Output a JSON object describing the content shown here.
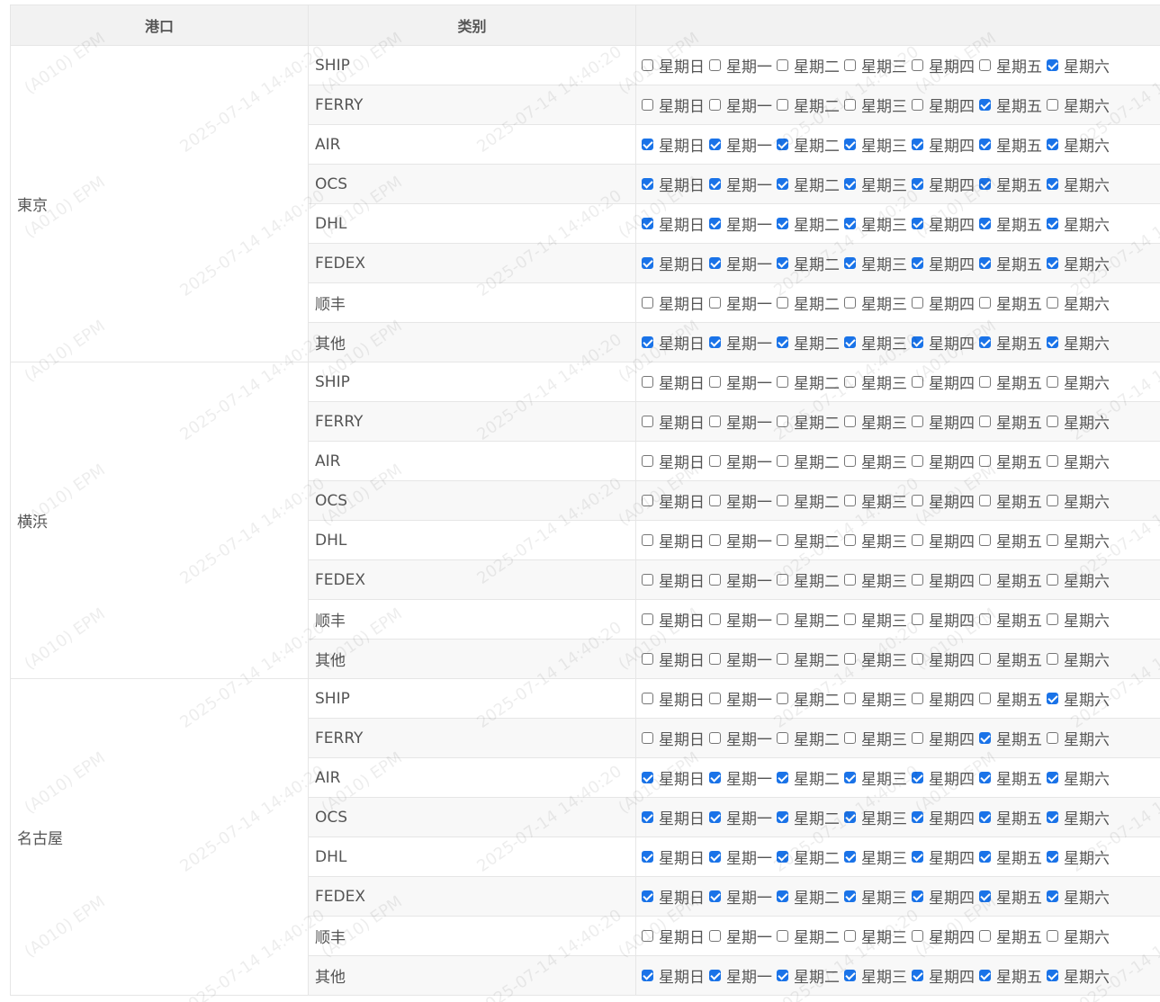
{
  "headers": {
    "port": "港口",
    "category": "类别",
    "days": ""
  },
  "weekdays": [
    "星期日",
    "星期一",
    "星期二",
    "星期三",
    "星期四",
    "星期五",
    "星期六"
  ],
  "watermark": {
    "text1": "(A010) EPM",
    "text2": "2025-07-14 14:40:20"
  },
  "ports": [
    {
      "name": "東京",
      "rows": [
        {
          "category": "SHIP",
          "checked": [
            false,
            false,
            false,
            false,
            false,
            false,
            true
          ]
        },
        {
          "category": "FERRY",
          "checked": [
            false,
            false,
            false,
            false,
            false,
            true,
            false
          ]
        },
        {
          "category": "AIR",
          "checked": [
            true,
            true,
            true,
            true,
            true,
            true,
            true
          ]
        },
        {
          "category": "OCS",
          "checked": [
            true,
            true,
            true,
            true,
            true,
            true,
            true
          ]
        },
        {
          "category": "DHL",
          "checked": [
            true,
            true,
            true,
            true,
            true,
            true,
            true
          ]
        },
        {
          "category": "FEDEX",
          "checked": [
            true,
            true,
            true,
            true,
            true,
            true,
            true
          ]
        },
        {
          "category": "顺丰",
          "checked": [
            false,
            false,
            false,
            false,
            false,
            false,
            false
          ]
        },
        {
          "category": "其他",
          "checked": [
            true,
            true,
            true,
            true,
            true,
            true,
            true
          ]
        }
      ]
    },
    {
      "name": "横浜",
      "rows": [
        {
          "category": "SHIP",
          "checked": [
            false,
            false,
            false,
            false,
            false,
            false,
            false
          ]
        },
        {
          "category": "FERRY",
          "checked": [
            false,
            false,
            false,
            false,
            false,
            false,
            false
          ]
        },
        {
          "category": "AIR",
          "checked": [
            false,
            false,
            false,
            false,
            false,
            false,
            false
          ]
        },
        {
          "category": "OCS",
          "checked": [
            false,
            false,
            false,
            false,
            false,
            false,
            false
          ]
        },
        {
          "category": "DHL",
          "checked": [
            false,
            false,
            false,
            false,
            false,
            false,
            false
          ]
        },
        {
          "category": "FEDEX",
          "checked": [
            false,
            false,
            false,
            false,
            false,
            false,
            false
          ]
        },
        {
          "category": "顺丰",
          "checked": [
            false,
            false,
            false,
            false,
            false,
            false,
            false
          ]
        },
        {
          "category": "其他",
          "checked": [
            false,
            false,
            false,
            false,
            false,
            false,
            false
          ]
        }
      ]
    },
    {
      "name": "名古屋",
      "rows": [
        {
          "category": "SHIP",
          "checked": [
            false,
            false,
            false,
            false,
            false,
            false,
            true
          ]
        },
        {
          "category": "FERRY",
          "checked": [
            false,
            false,
            false,
            false,
            false,
            true,
            false
          ]
        },
        {
          "category": "AIR",
          "checked": [
            true,
            true,
            true,
            true,
            true,
            true,
            true
          ]
        },
        {
          "category": "OCS",
          "checked": [
            true,
            true,
            true,
            true,
            true,
            true,
            true
          ]
        },
        {
          "category": "DHL",
          "checked": [
            true,
            true,
            true,
            true,
            true,
            true,
            true
          ]
        },
        {
          "category": "FEDEX",
          "checked": [
            true,
            true,
            true,
            true,
            true,
            true,
            true
          ]
        },
        {
          "category": "顺丰",
          "checked": [
            false,
            false,
            false,
            false,
            false,
            false,
            false
          ]
        },
        {
          "category": "其他",
          "checked": [
            true,
            true,
            true,
            true,
            true,
            true,
            true
          ]
        }
      ]
    }
  ]
}
